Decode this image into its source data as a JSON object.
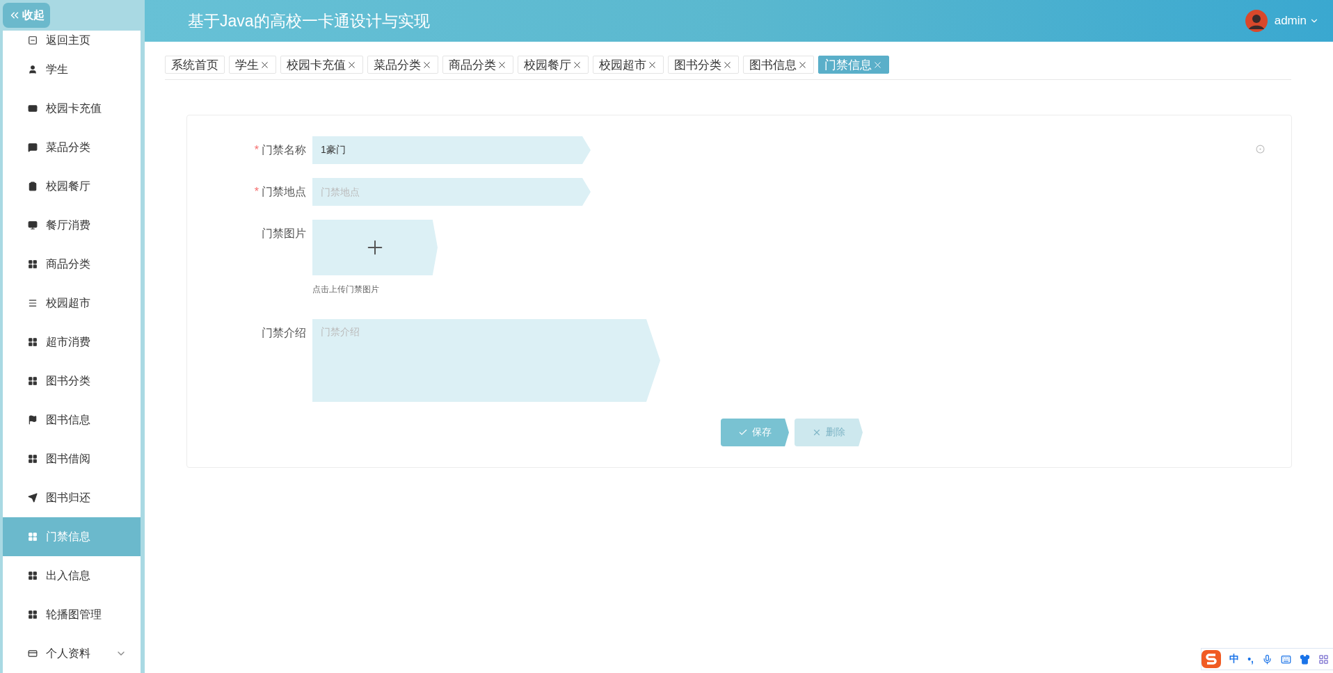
{
  "header": {
    "collapse_label": "收起",
    "title": "基于Java的高校一卡通设计与实现",
    "user": "admin"
  },
  "sidebar": {
    "items": [
      {
        "label": "返回主页",
        "selected": false
      },
      {
        "label": "学生",
        "selected": false
      },
      {
        "label": "校园卡充值",
        "selected": false
      },
      {
        "label": "菜品分类",
        "selected": false
      },
      {
        "label": "校园餐厅",
        "selected": false
      },
      {
        "label": "餐厅消费",
        "selected": false
      },
      {
        "label": "商品分类",
        "selected": false
      },
      {
        "label": "校园超市",
        "selected": false
      },
      {
        "label": "超市消费",
        "selected": false
      },
      {
        "label": "图书分类",
        "selected": false
      },
      {
        "label": "图书信息",
        "selected": false
      },
      {
        "label": "图书借阅",
        "selected": false
      },
      {
        "label": "图书归还",
        "selected": false
      },
      {
        "label": "门禁信息",
        "selected": true
      },
      {
        "label": "出入信息",
        "selected": false
      },
      {
        "label": "轮播图管理",
        "selected": false
      },
      {
        "label": "个人资料",
        "selected": false,
        "expanded": false
      }
    ]
  },
  "tabs": [
    {
      "label": "系统首页",
      "selected": false,
      "closable": false
    },
    {
      "label": "学生",
      "selected": false,
      "closable": true
    },
    {
      "label": "校园卡充值",
      "selected": false,
      "closable": true
    },
    {
      "label": "菜品分类",
      "selected": false,
      "closable": true
    },
    {
      "label": "商品分类",
      "selected": false,
      "closable": true
    },
    {
      "label": "校园餐厅",
      "selected": false,
      "closable": true
    },
    {
      "label": "校园超市",
      "selected": false,
      "closable": true
    },
    {
      "label": "图书分类",
      "selected": false,
      "closable": true
    },
    {
      "label": "图书信息",
      "selected": false,
      "closable": true
    },
    {
      "label": "门禁信息",
      "selected": true,
      "closable": true
    }
  ],
  "form": {
    "required_mark": "*",
    "fields": [
      {
        "kind": "input",
        "label": "门禁名称",
        "required": true,
        "value": "1豪门"
      },
      {
        "kind": "input",
        "label": "门禁地点",
        "required": true,
        "placeholder": "门禁地点"
      },
      {
        "kind": "upload",
        "label": "门禁图片",
        "required": false,
        "hint": "点击上传门禁图片"
      },
      {
        "kind": "textarea",
        "label": "门禁介绍",
        "required": false,
        "placeholder": "门禁介绍"
      }
    ],
    "buttons": [
      {
        "kind": "primary",
        "label": "保存"
      },
      {
        "kind": "danger",
        "label": "删除"
      }
    ]
  },
  "ime": {
    "mode": "中",
    "punct": "•,"
  }
}
